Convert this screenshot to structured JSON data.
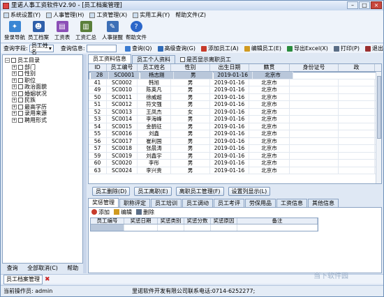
{
  "window": {
    "title": "里诺人事工资软件V2.90 - [员工档案管理]"
  },
  "menu": [
    {
      "label": "系统设置(Y)"
    },
    {
      "label": "人事管理(H)"
    },
    {
      "label": "工资管理(X)"
    },
    {
      "label": "实用工具(Y)"
    },
    {
      "label": "帮助文件(Z)"
    }
  ],
  "toolbar": [
    {
      "label": "登录导航",
      "icon": "compass-icon",
      "color": "#3a86d4"
    },
    {
      "label": "员工档案",
      "icon": "person-icon",
      "color": "#2f5faa"
    },
    {
      "label": "工资表",
      "icon": "sheet-icon",
      "color": "#8b4fb6"
    },
    {
      "label": "工资汇总",
      "icon": "chart-icon",
      "color": "#5a7f3a"
    },
    {
      "label": "人事提醒",
      "icon": "bell-icon",
      "color": "#3d6fb6"
    },
    {
      "label": "帮助文件",
      "icon": "help-icon",
      "color": "#2b66c9"
    }
  ],
  "query": {
    "field_label": "查询字段:",
    "field_value": "员工姓名",
    "info_label": "查询信息:",
    "buttons": [
      {
        "label": "查询(Q)",
        "color": "#3b7bd0"
      },
      {
        "label": "高级查询(G)",
        "color": "#2f6bb8"
      },
      {
        "label": "添加员工(A)",
        "color": "#c73b2b"
      },
      {
        "label": "编辑员工(E)",
        "color": "#d09a20"
      },
      {
        "label": "导出Excel(X)",
        "color": "#2a8c3e"
      },
      {
        "label": "打印(P)",
        "color": "#5a6d86"
      },
      {
        "label": "退出",
        "color": "#9b2f2f"
      }
    ]
  },
  "tree": {
    "root": "员工目录",
    "items": [
      "部门",
      "性别",
      "职位",
      "政治面貌",
      "婚姻状况",
      "民族",
      "最高学历",
      "录用来源",
      "聘用形式"
    ]
  },
  "left_buttons": [
    "查询",
    "全部取消(C)",
    "帮助"
  ],
  "tabs_top": [
    "员工资料信息",
    "员工个人资料"
  ],
  "show_left_label": "是否显示离职员工",
  "grid": {
    "columns": [
      "ID",
      "员工编号",
      "员工姓名",
      "性别",
      "出生日期",
      "籍贯",
      "身份证号",
      "政"
    ],
    "rows": [
      [
        "28",
        "SC0001",
        "杨志刚",
        "男",
        "2019-01-16",
        "北京市",
        "",
        ""
      ],
      [
        "41",
        "SC0002",
        "韩旭",
        "男",
        "2019-01-16",
        "北京市",
        "",
        ""
      ],
      [
        "49",
        "SC0010",
        "陈英凡",
        "男",
        "2019-01-16",
        "北京市",
        "",
        ""
      ],
      [
        "50",
        "SC0011",
        "徐威超",
        "男",
        "2019-01-16",
        "北京市",
        "",
        ""
      ],
      [
        "51",
        "SC0012",
        "符文强",
        "男",
        "2019-01-16",
        "北京市",
        "",
        ""
      ],
      [
        "52",
        "SC0013",
        "王凤杰",
        "女",
        "2019-01-16",
        "北京市",
        "",
        ""
      ],
      [
        "53",
        "SC0014",
        "李海峰",
        "男",
        "2019-01-16",
        "北京市",
        "",
        ""
      ],
      [
        "54",
        "SC0015",
        "金鹤征",
        "男",
        "2019-01-16",
        "北京市",
        "",
        ""
      ],
      [
        "55",
        "SC0016",
        "刘鑫",
        "男",
        "2019-01-16",
        "北京市",
        "",
        ""
      ],
      [
        "56",
        "SC0017",
        "崔利国",
        "男",
        "2019-01-16",
        "北京市",
        "",
        ""
      ],
      [
        "57",
        "SC0018",
        "张晨涛",
        "男",
        "2019-01-16",
        "北京市",
        "",
        ""
      ],
      [
        "59",
        "SC0019",
        "刘鑫宇",
        "男",
        "2019-01-16",
        "北京市",
        "",
        ""
      ],
      [
        "60",
        "SC0020",
        "李彤",
        "男",
        "2019-01-16",
        "北京市",
        "",
        ""
      ],
      [
        "63",
        "SC0024",
        "李兴贵",
        "男",
        "2019-01-16",
        "北京市",
        "",
        ""
      ]
    ]
  },
  "action_buttons": [
    "员工删除(D)",
    "员工离职(E)",
    "离职员工管理(F)",
    "设置列显示(L)"
  ],
  "tabs_bottom": [
    "奖惩管理",
    "职称评定",
    "员工培训",
    "员工调动",
    "员工考评",
    "劳保用品",
    "工资信息",
    "其他信息"
  ],
  "sub_toolbar": [
    "添加",
    "编辑",
    "删除"
  ],
  "sub_grid": {
    "columns": [
      "员工编号",
      "奖惩日期",
      "奖惩类别",
      "奖惩分数",
      "奖惩原因",
      "备注"
    ]
  },
  "doc_tab": "员工档案管理",
  "status": {
    "operator": "当前操作员: admin",
    "company": "里诺软件开发有限公司联系电话:0714-6252277;"
  },
  "watermark": "当下软件园"
}
